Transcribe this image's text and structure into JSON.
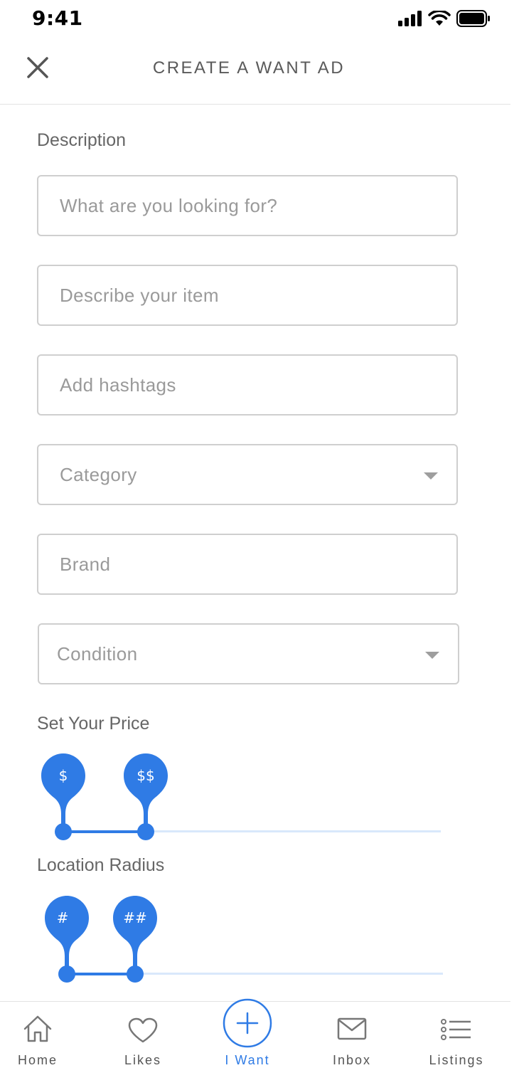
{
  "status_bar": {
    "time": "9:41"
  },
  "header": {
    "title": "CREATE A WANT AD"
  },
  "form": {
    "description_label": "Description",
    "looking_for_placeholder": "What are you looking for?",
    "describe_placeholder": "Describe your item",
    "hashtags_placeholder": "Add hashtags",
    "category_value": "Category",
    "brand_placeholder": "Brand",
    "condition_value": "Condition",
    "price_label": "Set Your Price",
    "price_min_label": "$",
    "price_max_label": "$$",
    "radius_label": "Location Radius",
    "radius_min_label": "#",
    "radius_max_label": "##"
  },
  "tabbar": {
    "home": "Home",
    "likes": "Likes",
    "iwant": "I Want",
    "inbox": "Inbox",
    "listings": "Listings"
  },
  "colors": {
    "accent": "#2f7be5",
    "track": "#d9e8fb"
  },
  "icons": [
    "close-icon",
    "home-icon",
    "heart-icon",
    "plus-icon",
    "mail-icon",
    "list-icon"
  ]
}
